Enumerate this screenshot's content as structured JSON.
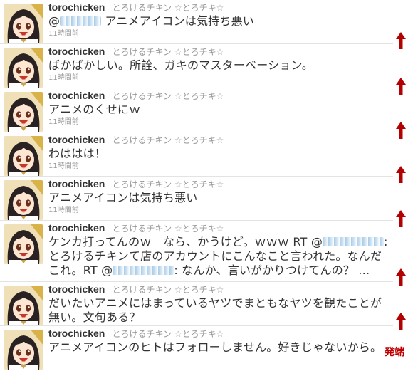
{
  "user": {
    "screen_name": "torochicken",
    "full_name": "とろけるチキン ☆とろチキ☆"
  },
  "colors": {
    "arrow": "#b30000",
    "mention_mask": "#a9cbe6",
    "time_text": "#999999"
  },
  "tweets": [
    {
      "pre": "@",
      "post": " アニメアイコンは気持ち悪い",
      "time": "11時間前"
    },
    {
      "text": "ばかばかしい。所詮、ガキのマスターベーション。",
      "time": "11時間前"
    },
    {
      "text": "アニメのくせにｗ",
      "time": "11時間前"
    },
    {
      "text": "わははは！",
      "time": "11時間前"
    },
    {
      "text": "アニメアイコンは気持ち悪い",
      "time": "11時間前"
    },
    {
      "part1": "ケンカ打ってんのｗ　なら、かうけど。ｗｗｗ RT @",
      "part2": ": とろけるチキンて店のアカウントにこんなこと言われた。なんだこれ。RT @",
      "part3": ": なんか、言いがかりつけてんの？ ..."
    },
    {
      "text": "だいたいアニメにはまっているヤツでまともなヤツを観たことが無い。文句ある？"
    },
    {
      "text": "アニメアイコンのヒトはフォローしません。好きじゃないから。"
    }
  ],
  "icons": {
    "arrow": "up-arrow-icon",
    "avatar": "anime-character-avatar"
  },
  "annotation": {
    "origin_label": "発端"
  }
}
